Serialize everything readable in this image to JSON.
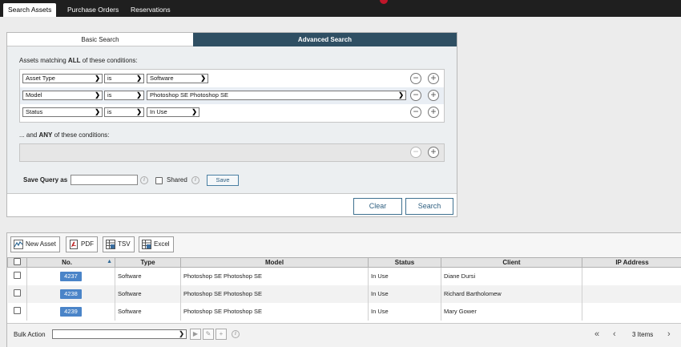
{
  "topbar": {
    "tabs": [
      {
        "label": "Search Assets",
        "active": true
      },
      {
        "label": "Purchase Orders",
        "active": false
      },
      {
        "label": "Reservations",
        "active": false
      }
    ]
  },
  "search_panel": {
    "tab_basic": "Basic Search",
    "tab_advanced": "Advanced Search",
    "all_prefix": "Assets matching ",
    "all_emph": "ALL",
    "all_suffix": " of these conditions:",
    "conditions": [
      {
        "field": "Asset Type",
        "op": "is",
        "value": "Software"
      },
      {
        "field": "Model",
        "op": "is",
        "value": "Photoshop SE Photoshop SE"
      },
      {
        "field": "Status",
        "op": "is",
        "value": "In Use"
      }
    ],
    "any_prefix": "... and ",
    "any_emph": "ANY",
    "any_suffix": " of these conditions:",
    "save_query_label": "Save Query as",
    "save_query_value": "",
    "shared_label": "Shared",
    "save_button": "Save",
    "clear_button": "Clear",
    "search_button": "Search"
  },
  "results": {
    "toolbar": {
      "new_asset": "New Asset",
      "pdf": "PDF",
      "tsv": "TSV",
      "excel": "Excel"
    },
    "columns": [
      "No.",
      "Type",
      "Model",
      "Status",
      "Client",
      "IP Address"
    ],
    "rows": [
      {
        "no": "4237",
        "type": "Software",
        "model": "Photoshop SE Photoshop SE",
        "status": "In Use",
        "client": "Diane Dursi",
        "ip": ""
      },
      {
        "no": "4238",
        "type": "Software",
        "model": "Photoshop SE Photoshop SE",
        "status": "In Use",
        "client": "Richard Bartholomew",
        "ip": ""
      },
      {
        "no": "4239",
        "type": "Software",
        "model": "Photoshop SE Photoshop SE",
        "status": "In Use",
        "client": "Mary Gower",
        "ip": ""
      }
    ],
    "bulk_action_label": "Bulk Action",
    "bulk_action_value": "",
    "items_count": "3 Items"
  },
  "icons": {
    "remove": "minus-circle-icon",
    "add": "plus-circle-icon",
    "info": "info-icon",
    "sort": "sort-asc-icon"
  },
  "colors": {
    "topbar": "#1f1f1f",
    "accent": "#2f4f63",
    "badge": "#4a84c8"
  }
}
